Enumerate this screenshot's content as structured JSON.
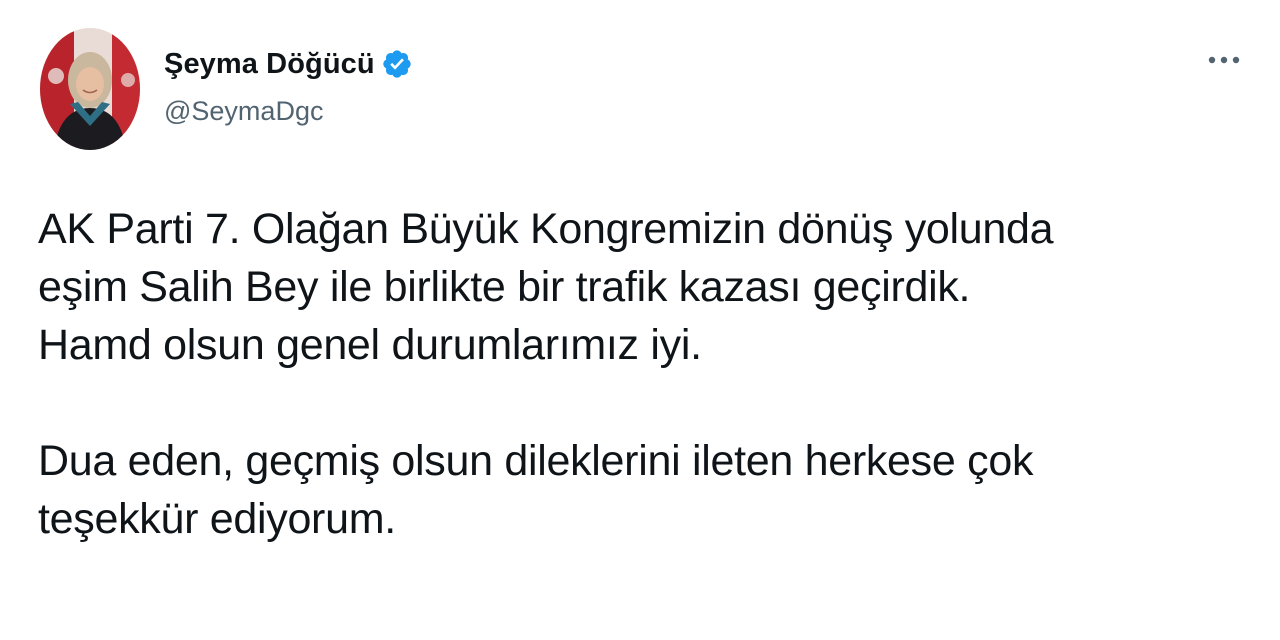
{
  "tweet": {
    "author": {
      "display_name": "Şeyma Döğücü",
      "handle": "@SeymaDgc",
      "verified": true,
      "avatar_icon": "profile-photo"
    },
    "more_icon": "more-horizontal-icon",
    "text": {
      "paragraph_1": [
        "AK Parti 7. Olağan Büyük Kongremizin dönüş yolunda",
        "eşim Salih Bey ile birlikte bir trafik kazası geçirdik.",
        "Hamd olsun genel durumlarımız iyi."
      ],
      "paragraph_2": [
        "Dua eden, geçmiş olsun dileklerini ileten herkese çok",
        "teşekkür ediyorum."
      ]
    },
    "colors": {
      "text_primary": "#0f1419",
      "text_secondary": "#536471",
      "verified_blue": "#1d9bf0"
    }
  }
}
